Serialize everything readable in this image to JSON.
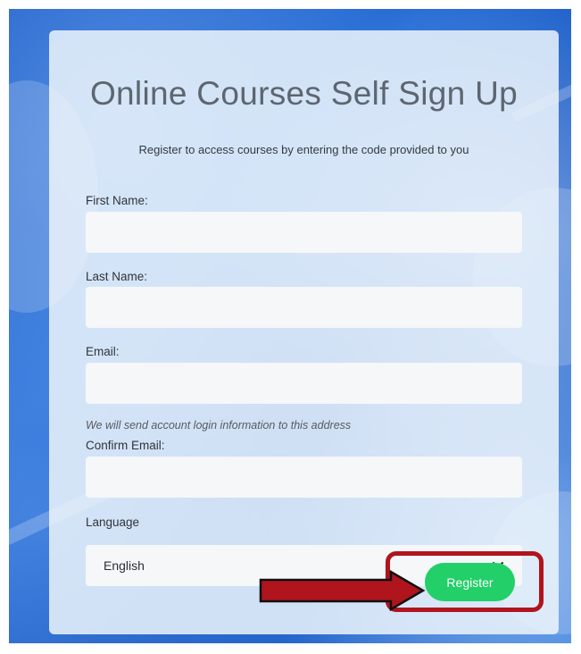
{
  "form": {
    "title": "Online Courses Self Sign Up",
    "subtitle": "Register to access courses by entering the code provided to you",
    "first_name_label": "First Name:",
    "first_name_value": "",
    "last_name_label": "Last Name:",
    "last_name_value": "",
    "email_label": "Email:",
    "email_value": "",
    "email_hint": "We will send account login information to this address",
    "confirm_email_label": "Confirm Email:",
    "confirm_email_value": "",
    "language_label": "Language",
    "language_selected": "English",
    "register_label": "Register"
  },
  "icons": {
    "dropdown": "chevron-down-icon",
    "annotation": "arrow-right-icon"
  },
  "colors": {
    "register_button": "#22cf68",
    "annotation": "#b0141d",
    "background": "#1e5fc9"
  }
}
